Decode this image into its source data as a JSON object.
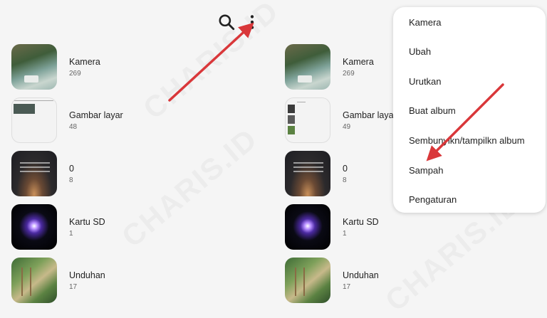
{
  "watermark": "CHARIS.ID",
  "toolbar": {
    "search_icon": "search-icon",
    "more_icon": "more-vert-icon"
  },
  "left_albums": [
    {
      "name": "Kamera",
      "count": "269"
    },
    {
      "name": "Gambar layar",
      "count": "48"
    },
    {
      "name": "0",
      "count": "8"
    },
    {
      "name": "Kartu SD",
      "count": "1"
    },
    {
      "name": "Unduhan",
      "count": "17"
    }
  ],
  "right_albums": [
    {
      "name": "Kamera",
      "count": "269"
    },
    {
      "name": "Gambar layar",
      "count": "49"
    },
    {
      "name": "0",
      "count": "8"
    },
    {
      "name": "Kartu SD",
      "count": "1"
    },
    {
      "name": "Unduhan",
      "count": "17"
    }
  ],
  "menu": {
    "items": [
      "Kamera",
      "Ubah",
      "Urutkan",
      "Buat album",
      "Sembunyikn/tampilkn album",
      "Sampah",
      "Pengaturan"
    ]
  },
  "colors": {
    "arrow": "#d9373a",
    "menu_bg": "#ffffff",
    "page_bg": "#f5f5f5"
  }
}
